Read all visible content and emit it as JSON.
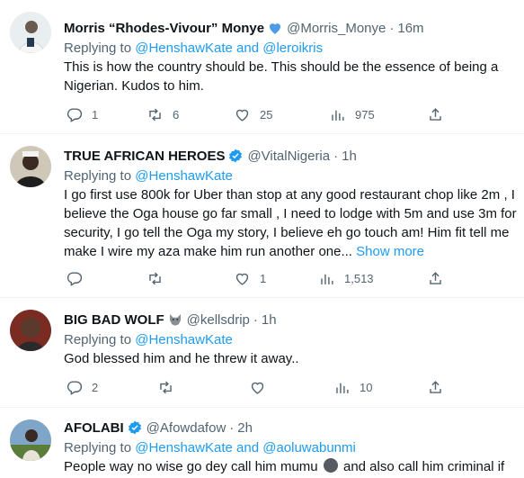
{
  "colors": {
    "link": "#1d9bf0",
    "muted": "#536471",
    "text": "#0f1419",
    "heart_emoji": "#4c9be8",
    "verified": "#1d9bf0"
  },
  "tweets": [
    {
      "name": "Morris “Rhodes-Vivour” Monye",
      "badge": "blue-heart",
      "handle": "@Morris_Monye",
      "time": "16m",
      "replying_prefix": "Replying to",
      "replying_to": [
        "@HenshawKate",
        "@leroikris"
      ],
      "replying_join": "and",
      "text": "This is how the country should be. This should be the essence of being a Nigerian. Kudos to him.",
      "reply_count": "1",
      "retweet_count": "6",
      "like_count": "25",
      "view_count": "975"
    },
    {
      "name": "TRUE AFRICAN HEROES",
      "badge": "verified",
      "handle": "@VitalNigeria",
      "time": "1h",
      "replying_prefix": "Replying to",
      "replying_to": [
        "@HenshawKate"
      ],
      "text": "I go first use 800k for Uber than stop at any good restaurant chop like 2m , I believe the Oga house go far small , I need to lodge with 5m and use 3m for security, I go tell the Oga my story, I believe eh go touch am! Him fit tell me make I wire my aza make him run another one...",
      "show_more": "Show more",
      "reply_count": "",
      "retweet_count": "",
      "like_count": "1",
      "view_count": "1,513"
    },
    {
      "name": "BIG BAD WOLF",
      "badge": "wolf-emoji",
      "handle": "@kellsdrip",
      "time": "1h",
      "replying_prefix": "Replying to",
      "replying_to": [
        "@HenshawKate"
      ],
      "text": "God blessed him and he threw it away..",
      "reply_count": "2",
      "retweet_count": "",
      "like_count": "",
      "view_count": "10"
    },
    {
      "name": "AFOLABI",
      "badge": "verified",
      "handle": "@Afowdafow",
      "time": "2h",
      "replying_prefix": "Replying to",
      "replying_to": [
        "@HenshawKate",
        "@aoluwabunmi"
      ],
      "replying_join": "and",
      "text_before_emoji": "People way no wise go dey call him mumu",
      "emoji": "grinning-face-emoji",
      "text_after_emoji": "and also call him criminal if"
    }
  ],
  "separator": "·"
}
